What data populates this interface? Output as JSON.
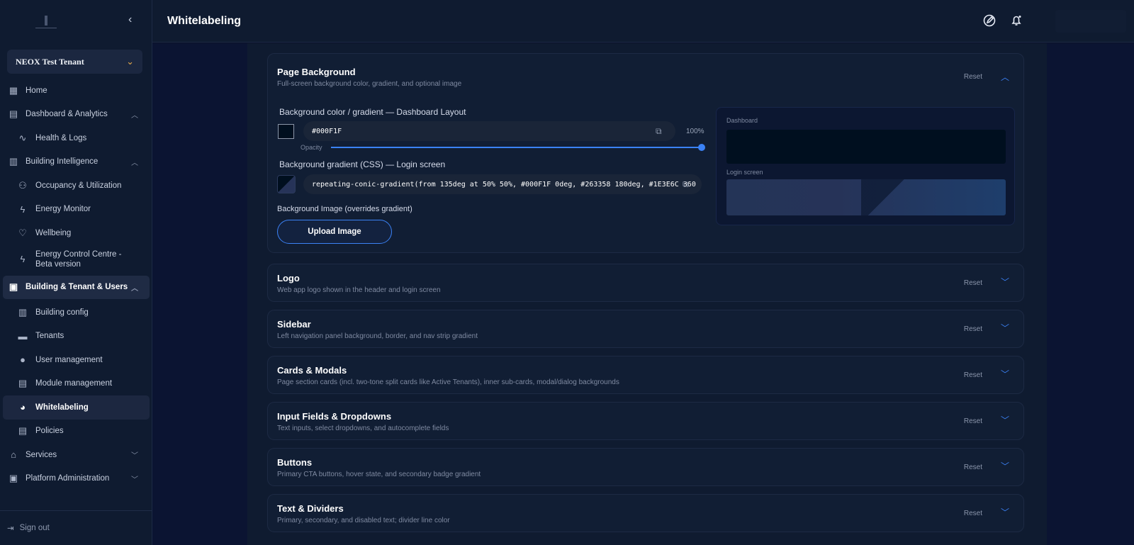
{
  "header": {
    "title": "Whitelabeling"
  },
  "tenant": {
    "name": "NEOX Test Tenant"
  },
  "nav": {
    "home": "Home",
    "dashboard": "Dashboard & Analytics",
    "health": "Health & Logs",
    "building_intel": "Building Intelligence",
    "occupancy": "Occupancy & Utilization",
    "energy_monitor": "Energy Monitor",
    "wellbeing": "Wellbeing",
    "ecc_line1": "Energy Control Centre -",
    "ecc_line2": "Beta version",
    "btu": "Building & Tenant & Users",
    "building_config": "Building config",
    "tenants": "Tenants",
    "user_mgmt": "User management",
    "module_mgmt": "Module management",
    "whitelabeling": "Whitelabeling",
    "policies": "Policies",
    "services": "Services",
    "platform_admin": "Platform Administration",
    "sign_out": "Sign out"
  },
  "page_background": {
    "title": "Page Background",
    "desc": "Full-screen background color, gradient, and optional image",
    "reset": "Reset",
    "bg_color_label": "Background color / gradient — Dashboard Layout",
    "bg_color_value": "#000F1F",
    "opacity_label": "Opacity",
    "opacity_value": "100%",
    "opacity": 1.0,
    "gradient_label": "Background gradient (CSS) — Login screen",
    "gradient_value": "repeating-conic-gradient(from 135deg at 50% 50%, #000F1F 0deg, #263358 180deg, #1E3E6C 360",
    "image_label": "Background Image (overrides gradient)",
    "upload_label": "Upload Image",
    "preview_dashboard": "Dashboard",
    "preview_login": "Login screen"
  },
  "sections": {
    "logo": {
      "title": "Logo",
      "desc": "Web app logo shown in the header and login screen",
      "reset": "Reset"
    },
    "sidebar": {
      "title": "Sidebar",
      "desc": "Left navigation panel background, border, and nav strip gradient",
      "reset": "Reset"
    },
    "cards": {
      "title": "Cards & Modals",
      "desc": "Page section cards (incl. two-tone split cards like Active Tenants), inner sub-cards, modal/dialog backgrounds",
      "reset": "Reset"
    },
    "inputs": {
      "title": "Input Fields & Dropdowns",
      "desc": "Text inputs, select dropdowns, and autocomplete fields",
      "reset": "Reset"
    },
    "buttons": {
      "title": "Buttons",
      "desc": "Primary CTA buttons, hover state, and secondary badge gradient",
      "reset": "Reset"
    },
    "text": {
      "title": "Text & Dividers",
      "desc": "Primary, secondary, and disabled text; divider line color",
      "reset": "Reset"
    }
  },
  "colors": {
    "accent": "#3B82F6",
    "dashboard_bg": "#000F1F",
    "gradient_2": "#263358",
    "gradient_3": "#1E3E6C"
  },
  "icons": [
    "collapse-icon",
    "chevron-down-icon",
    "home-icon",
    "dashboard-icon",
    "pulse-icon",
    "building-icon",
    "users-icon",
    "lightning-icon",
    "heart-icon",
    "palette-icon",
    "user-icon",
    "sign-out-icon",
    "edit-icon",
    "bell-icon",
    "copy-icon",
    "chevron-up-icon"
  ]
}
